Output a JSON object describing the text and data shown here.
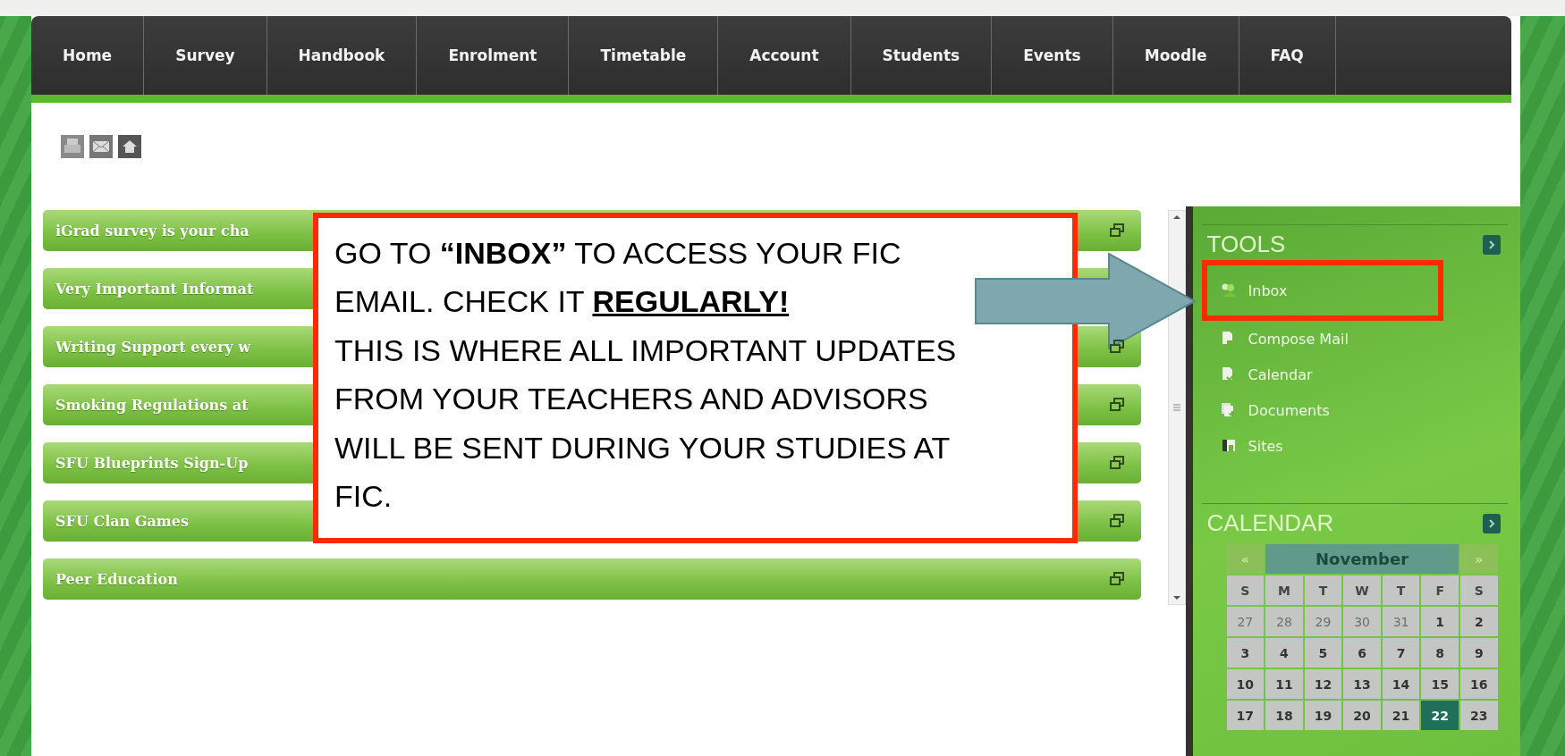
{
  "nav": [
    "Home",
    "Survey",
    "Handbook",
    "Enrolment",
    "Timetable",
    "Account",
    "Students",
    "Events",
    "Moodle",
    "FAQ"
  ],
  "announcements": [
    {
      "title": "iGrad survey is your cha",
      "restore_icon": true
    },
    {
      "title": "Very Important Informat",
      "restore_icon": false
    },
    {
      "title": "Writing Support every w",
      "restore_icon": true
    },
    {
      "title": "Smoking Regulations at",
      "restore_icon": true
    },
    {
      "title": "SFU Blueprints Sign-Up",
      "restore_icon": true
    },
    {
      "title": "SFU Clan Games",
      "restore_icon": true
    },
    {
      "title": "Peer Education",
      "restore_icon": true
    }
  ],
  "sidebar": {
    "tools": {
      "title": "TOOLS",
      "items": [
        {
          "label": "Inbox",
          "highlighted": true
        },
        {
          "label": "Compose Mail",
          "highlighted": false
        },
        {
          "label": "Calendar",
          "highlighted": false
        },
        {
          "label": "Documents",
          "highlighted": false
        },
        {
          "label": "Sites",
          "highlighted": false
        }
      ]
    },
    "calendar": {
      "title": "CALENDAR",
      "prev": "«",
      "month": "November",
      "next": "»",
      "weekdays": [
        "S",
        "M",
        "T",
        "W",
        "T",
        "F",
        "S"
      ],
      "weeks": [
        [
          {
            "day": "27",
            "outside": true,
            "selected": false
          },
          {
            "day": "28",
            "outside": true,
            "selected": false
          },
          {
            "day": "29",
            "outside": true,
            "selected": false
          },
          {
            "day": "30",
            "outside": true,
            "selected": false
          },
          {
            "day": "31",
            "outside": true,
            "selected": false
          },
          {
            "day": "1",
            "outside": false,
            "selected": false
          },
          {
            "day": "2",
            "outside": false,
            "selected": false
          }
        ],
        [
          {
            "day": "3",
            "outside": false,
            "selected": false
          },
          {
            "day": "4",
            "outside": false,
            "selected": false
          },
          {
            "day": "5",
            "outside": false,
            "selected": false
          },
          {
            "day": "6",
            "outside": false,
            "selected": false
          },
          {
            "day": "7",
            "outside": false,
            "selected": false
          },
          {
            "day": "8",
            "outside": false,
            "selected": false
          },
          {
            "day": "9",
            "outside": false,
            "selected": false
          }
        ],
        [
          {
            "day": "10",
            "outside": false,
            "selected": false
          },
          {
            "day": "11",
            "outside": false,
            "selected": false
          },
          {
            "day": "12",
            "outside": false,
            "selected": false
          },
          {
            "day": "13",
            "outside": false,
            "selected": false
          },
          {
            "day": "14",
            "outside": false,
            "selected": false
          },
          {
            "day": "15",
            "outside": false,
            "selected": false
          },
          {
            "day": "16",
            "outside": false,
            "selected": false
          }
        ],
        [
          {
            "day": "17",
            "outside": false,
            "selected": false
          },
          {
            "day": "18",
            "outside": false,
            "selected": false
          },
          {
            "day": "19",
            "outside": false,
            "selected": false
          },
          {
            "day": "20",
            "outside": false,
            "selected": false
          },
          {
            "day": "21",
            "outside": false,
            "selected": false
          },
          {
            "day": "22",
            "outside": false,
            "selected": true
          },
          {
            "day": "23",
            "outside": false,
            "selected": false
          }
        ]
      ]
    }
  },
  "callout": {
    "lead": "GO TO **“INBOX”** TO ACCESS YOUR FIC EMAIL. CHECK IT",
    "emphasis": "REGULARLY!",
    "body": "THIS IS WHERE ALL IMPORTANT UPDATES FROM YOUR TEACHERS AND ADVISORS WILL BE SENT DURING YOUR STUDIES AT FIC."
  }
}
